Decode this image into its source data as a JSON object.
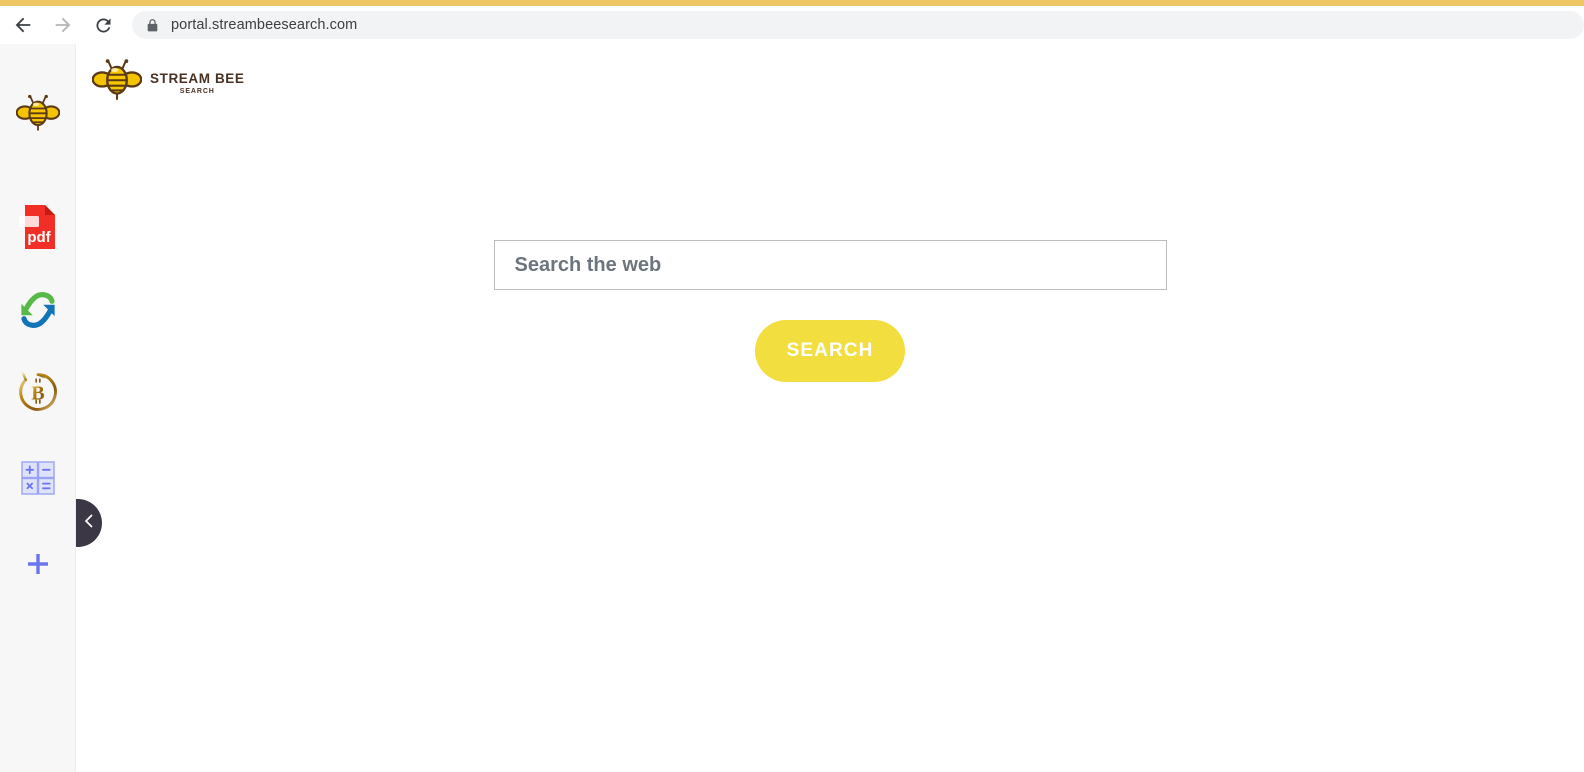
{
  "browser": {
    "back_label": "Back",
    "forward_label": "Forward",
    "reload_label": "Reload",
    "lock_icon": "lock-icon",
    "url": "portal.streambeesearch.com",
    "tab_accent_color": "#eec764"
  },
  "sidebar": {
    "background_color": "#f7f7f7",
    "items": [
      {
        "name": "bee",
        "label": "Stream Bee Search",
        "icon": "bee-icon"
      },
      {
        "name": "pdf",
        "label": "PDF Converter",
        "icon": "pdf-file-icon",
        "badge_text": "pdf"
      },
      {
        "name": "swap",
        "label": "File Converter",
        "icon": "swap-arrows-icon"
      },
      {
        "name": "bitcoin",
        "label": "Bitcoin",
        "icon": "bitcoin-icon",
        "symbol": "Ƀ"
      },
      {
        "name": "calculator",
        "label": "Calculator",
        "icon": "calculator-icon",
        "keys": [
          "+",
          "−",
          "×",
          "="
        ]
      },
      {
        "name": "add",
        "label": "Add Extension",
        "icon": "plus-icon"
      }
    ],
    "collapse_handle": {
      "icon": "chevron-left-icon",
      "label": "Collapse sidebar",
      "color": "#3b3744"
    }
  },
  "site": {
    "brand": {
      "icon": "bee-logo-icon",
      "name": "STREAM BEE",
      "tagline": "SEARCH"
    },
    "search": {
      "placeholder": "Search the web",
      "value": "",
      "button_label": "SEARCH",
      "button_color": "#f2de3f"
    }
  }
}
